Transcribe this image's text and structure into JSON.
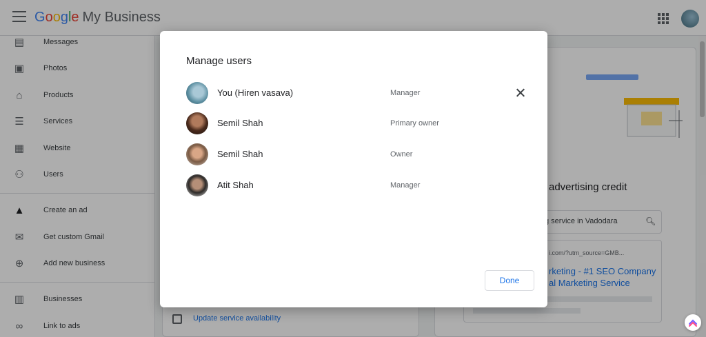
{
  "app": {
    "logo_letters": [
      "G",
      "o",
      "o",
      "g",
      "l",
      "e"
    ],
    "logo_suffix": "My Business"
  },
  "sidebar": {
    "items": [
      {
        "label": "Messages",
        "icon": "message-icon"
      },
      {
        "label": "Photos",
        "icon": "photos-icon"
      },
      {
        "label": "Products",
        "icon": "basket-icon"
      },
      {
        "label": "Services",
        "icon": "list-icon"
      },
      {
        "label": "Website",
        "icon": "website-icon"
      },
      {
        "label": "Users",
        "icon": "add-user-icon"
      },
      {
        "label": "Create an ad",
        "icon": "ads-icon"
      },
      {
        "label": "Get custom Gmail",
        "icon": "gmail-icon"
      },
      {
        "label": "Add new business",
        "icon": "location-add-icon"
      },
      {
        "label": "Businesses",
        "icon": "store-icon"
      },
      {
        "label": "Link to ads",
        "icon": "link-icon"
      }
    ]
  },
  "background": {
    "promo_title": "advertising credit",
    "search_text": "g service in Vadodara",
    "ad_url": "i.com/?utm_source=GMB...",
    "ad_line1": "rketing - #1 SEO Company",
    "ad_line2": "al Marketing Service",
    "update_link": "Update service availability"
  },
  "dialog": {
    "title": "Manage users",
    "users": [
      {
        "name": "You (Hiren vasava)",
        "role": "Manager"
      },
      {
        "name": "Semil Shah",
        "role": "Primary owner"
      },
      {
        "name": "Semil Shah",
        "role": "Owner"
      },
      {
        "name": "Atit Shah",
        "role": "Manager"
      }
    ],
    "done_label": "Done"
  },
  "colors": {
    "accent": "#1a73e8",
    "overlay": "rgba(0,0,0,0.32)"
  }
}
